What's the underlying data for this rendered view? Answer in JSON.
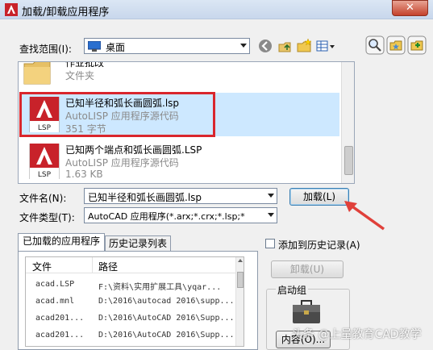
{
  "window": {
    "title": "加载/卸载应用程序",
    "close_glyph": "✕"
  },
  "look_in": {
    "label": "查找范围(I):",
    "value": "桌面"
  },
  "files": [
    {
      "name": "作业批改",
      "type": "文件夹",
      "size": ""
    },
    {
      "name": "已知半径和弧长画圆弧.lsp",
      "type": "AutoLISP 应用程序源代码",
      "size": "351 字节"
    },
    {
      "name": "已知两个端点和弧长画圆弧.LSP",
      "type": "AutoLISP 应用程序源代码",
      "size": "1.63 KB"
    }
  ],
  "lsp_badge": "LSP",
  "file_name": {
    "label": "文件名(N):",
    "value": "已知半径和弧长画圆弧.lsp"
  },
  "file_type": {
    "label": "文件类型(T):",
    "value": "AutoCAD 应用程序(*.arx;*.crx;*.lsp;*"
  },
  "load_button": "加载(L)",
  "tabs": [
    "已加载的应用程序",
    "历史记录列表"
  ],
  "columns": [
    "文件",
    "路径"
  ],
  "loaded_apps": [
    {
      "file": "acad.LSP",
      "path": "F:\\资料\\实用扩展工具\\yqar..."
    },
    {
      "file": "acad.mnl",
      "path": "D:\\2016\\autocad 2016\\supp..."
    },
    {
      "file": "acad201...",
      "path": "D:\\2016\\AutoCAD 2016\\Supp..."
    },
    {
      "file": "acad201...",
      "path": "D:\\2016\\AutoCAD 2016\\Supp..."
    }
  ],
  "add_to_history": {
    "label": "添加到历史记录(A)",
    "checked": false
  },
  "unload_button": "卸载(U)",
  "startup_group": {
    "title": "启动组",
    "contents_button": "内容(O)..."
  },
  "watermark": "头条 @上量教育CAD教学",
  "colors": {
    "highlight_box": "#d9262c",
    "arrow": "#e0403a",
    "selected_row": "#cde8ff",
    "autocad_red": "#c8222a"
  }
}
